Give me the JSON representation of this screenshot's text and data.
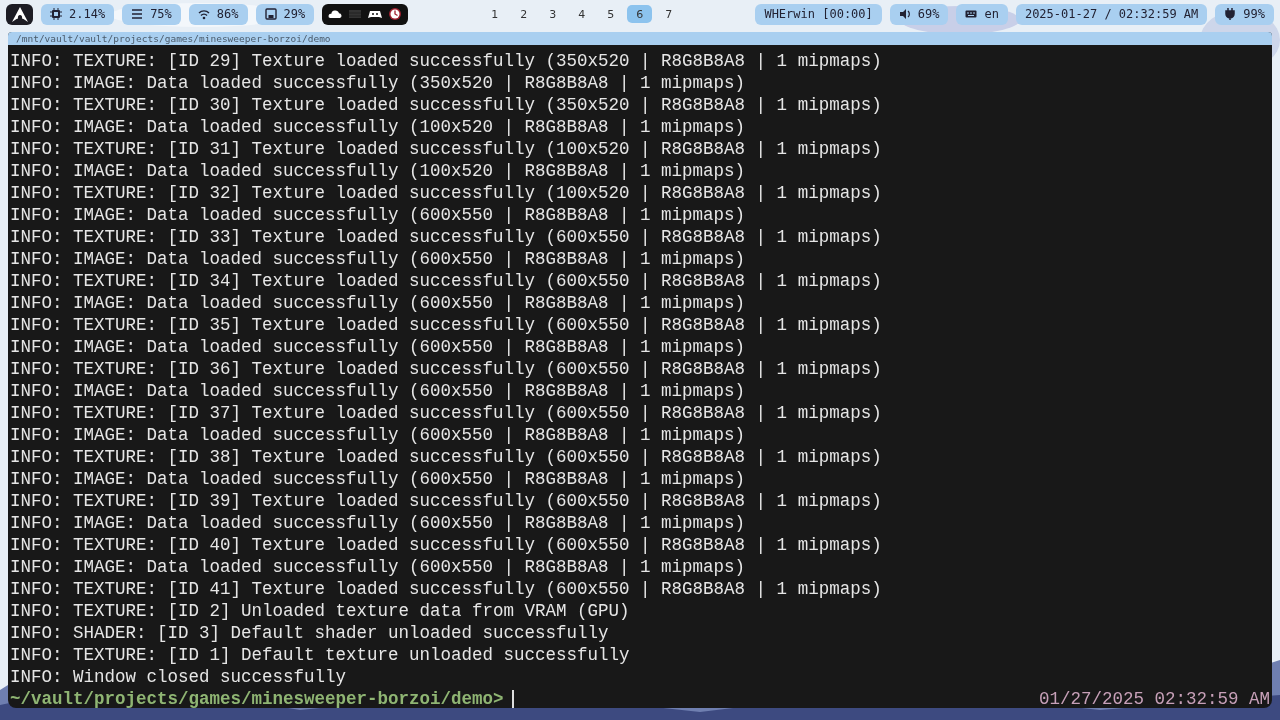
{
  "top_bar": {
    "stats": [
      {
        "kind": "cpu",
        "text": "2.14%"
      },
      {
        "kind": "memory",
        "text": "75%"
      },
      {
        "kind": "wifi",
        "text": "86%"
      },
      {
        "kind": "disk",
        "text": "29%"
      }
    ],
    "workspaces": [
      {
        "label": "1",
        "selected": false
      },
      {
        "label": "2",
        "selected": false
      },
      {
        "label": "3",
        "selected": false
      },
      {
        "label": "4",
        "selected": false
      },
      {
        "label": "5",
        "selected": false
      },
      {
        "label": "6",
        "selected": true
      },
      {
        "label": "7",
        "selected": false
      }
    ],
    "status": [
      {
        "kind": "user",
        "text": "WHErwin [00:00]"
      },
      {
        "kind": "volume",
        "text": "69%"
      },
      {
        "kind": "keyboard",
        "text": "en"
      },
      {
        "kind": "clock",
        "text": "2025-01-27 / 02:32:59 AM"
      },
      {
        "kind": "power",
        "text": "99%"
      }
    ]
  },
  "terminal": {
    "title": "/mnt/vault/vault/projects/games/minesweeper-borzoi/demo",
    "lines": [
      "INFO: TEXTURE: [ID 29] Texture loaded successfully (350x520 | R8G8B8A8 | 1 mipmaps)",
      "INFO: IMAGE: Data loaded successfully (350x520 | R8G8B8A8 | 1 mipmaps)",
      "INFO: TEXTURE: [ID 30] Texture loaded successfully (350x520 | R8G8B8A8 | 1 mipmaps)",
      "INFO: IMAGE: Data loaded successfully (100x520 | R8G8B8A8 | 1 mipmaps)",
      "INFO: TEXTURE: [ID 31] Texture loaded successfully (100x520 | R8G8B8A8 | 1 mipmaps)",
      "INFO: IMAGE: Data loaded successfully (100x520 | R8G8B8A8 | 1 mipmaps)",
      "INFO: TEXTURE: [ID 32] Texture loaded successfully (100x520 | R8G8B8A8 | 1 mipmaps)",
      "INFO: IMAGE: Data loaded successfully (600x550 | R8G8B8A8 | 1 mipmaps)",
      "INFO: TEXTURE: [ID 33] Texture loaded successfully (600x550 | R8G8B8A8 | 1 mipmaps)",
      "INFO: IMAGE: Data loaded successfully (600x550 | R8G8B8A8 | 1 mipmaps)",
      "INFO: TEXTURE: [ID 34] Texture loaded successfully (600x550 | R8G8B8A8 | 1 mipmaps)",
      "INFO: IMAGE: Data loaded successfully (600x550 | R8G8B8A8 | 1 mipmaps)",
      "INFO: TEXTURE: [ID 35] Texture loaded successfully (600x550 | R8G8B8A8 | 1 mipmaps)",
      "INFO: IMAGE: Data loaded successfully (600x550 | R8G8B8A8 | 1 mipmaps)",
      "INFO: TEXTURE: [ID 36] Texture loaded successfully (600x550 | R8G8B8A8 | 1 mipmaps)",
      "INFO: IMAGE: Data loaded successfully (600x550 | R8G8B8A8 | 1 mipmaps)",
      "INFO: TEXTURE: [ID 37] Texture loaded successfully (600x550 | R8G8B8A8 | 1 mipmaps)",
      "INFO: IMAGE: Data loaded successfully (600x550 | R8G8B8A8 | 1 mipmaps)",
      "INFO: TEXTURE: [ID 38] Texture loaded successfully (600x550 | R8G8B8A8 | 1 mipmaps)",
      "INFO: IMAGE: Data loaded successfully (600x550 | R8G8B8A8 | 1 mipmaps)",
      "INFO: TEXTURE: [ID 39] Texture loaded successfully (600x550 | R8G8B8A8 | 1 mipmaps)",
      "INFO: IMAGE: Data loaded successfully (600x550 | R8G8B8A8 | 1 mipmaps)",
      "INFO: TEXTURE: [ID 40] Texture loaded successfully (600x550 | R8G8B8A8 | 1 mipmaps)",
      "INFO: IMAGE: Data loaded successfully (600x550 | R8G8B8A8 | 1 mipmaps)",
      "INFO: TEXTURE: [ID 41] Texture loaded successfully (600x550 | R8G8B8A8 | 1 mipmaps)",
      "INFO: TEXTURE: [ID 2] Unloaded texture data from VRAM (GPU)",
      "INFO: SHADER: [ID 3] Default shader unloaded successfully",
      "INFO: TEXTURE: [ID 1] Default texture unloaded successfully",
      "INFO: Window closed successfully"
    ],
    "prompt": "~/vault/projects/games/minesweeper-borzoi/demo>",
    "right_prompt": "01/27/2025 02:32:59 AM"
  }
}
